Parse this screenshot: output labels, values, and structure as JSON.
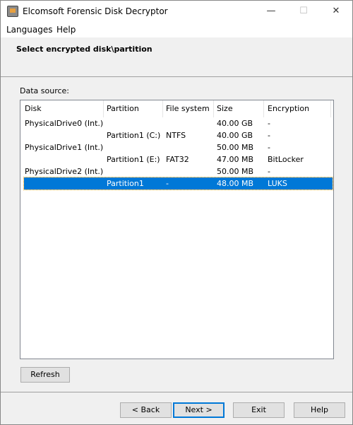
{
  "window": {
    "title": "Elcomsoft Forensic Disk Decryptor",
    "minimize": "—",
    "maximize": "☐",
    "close": "✕"
  },
  "menu": [
    "Languages",
    "Help"
  ],
  "header": {
    "title": "Select encrypted disk\\partition"
  },
  "data_source": {
    "label": "Data source:",
    "columns": [
      "Disk",
      "Partition",
      "File system",
      "Size",
      "Encryption"
    ],
    "rows": [
      [
        "PhysicalDrive0 (Int.)",
        "",
        "",
        "40.00 GB",
        "-"
      ],
      [
        "",
        "Partition1 (C:)",
        "NTFS",
        "40.00 GB",
        "-"
      ],
      [
        "PhysicalDrive1 (Int.)",
        "",
        "",
        "50.00 MB",
        "-"
      ],
      [
        "",
        "Partition1 (E:)",
        "FAT32",
        "47.00 MB",
        "BitLocker"
      ],
      [
        "PhysicalDrive2 (Int.)",
        "",
        "",
        "50.00 MB",
        "-"
      ],
      [
        "",
        "Partition1",
        "-",
        "48.00 MB",
        "LUKS"
      ]
    ],
    "selected_row": 5
  },
  "buttons": {
    "refresh": "Refresh",
    "back": "< Back",
    "next": "Next >",
    "exit": "Exit",
    "help": "Help"
  }
}
